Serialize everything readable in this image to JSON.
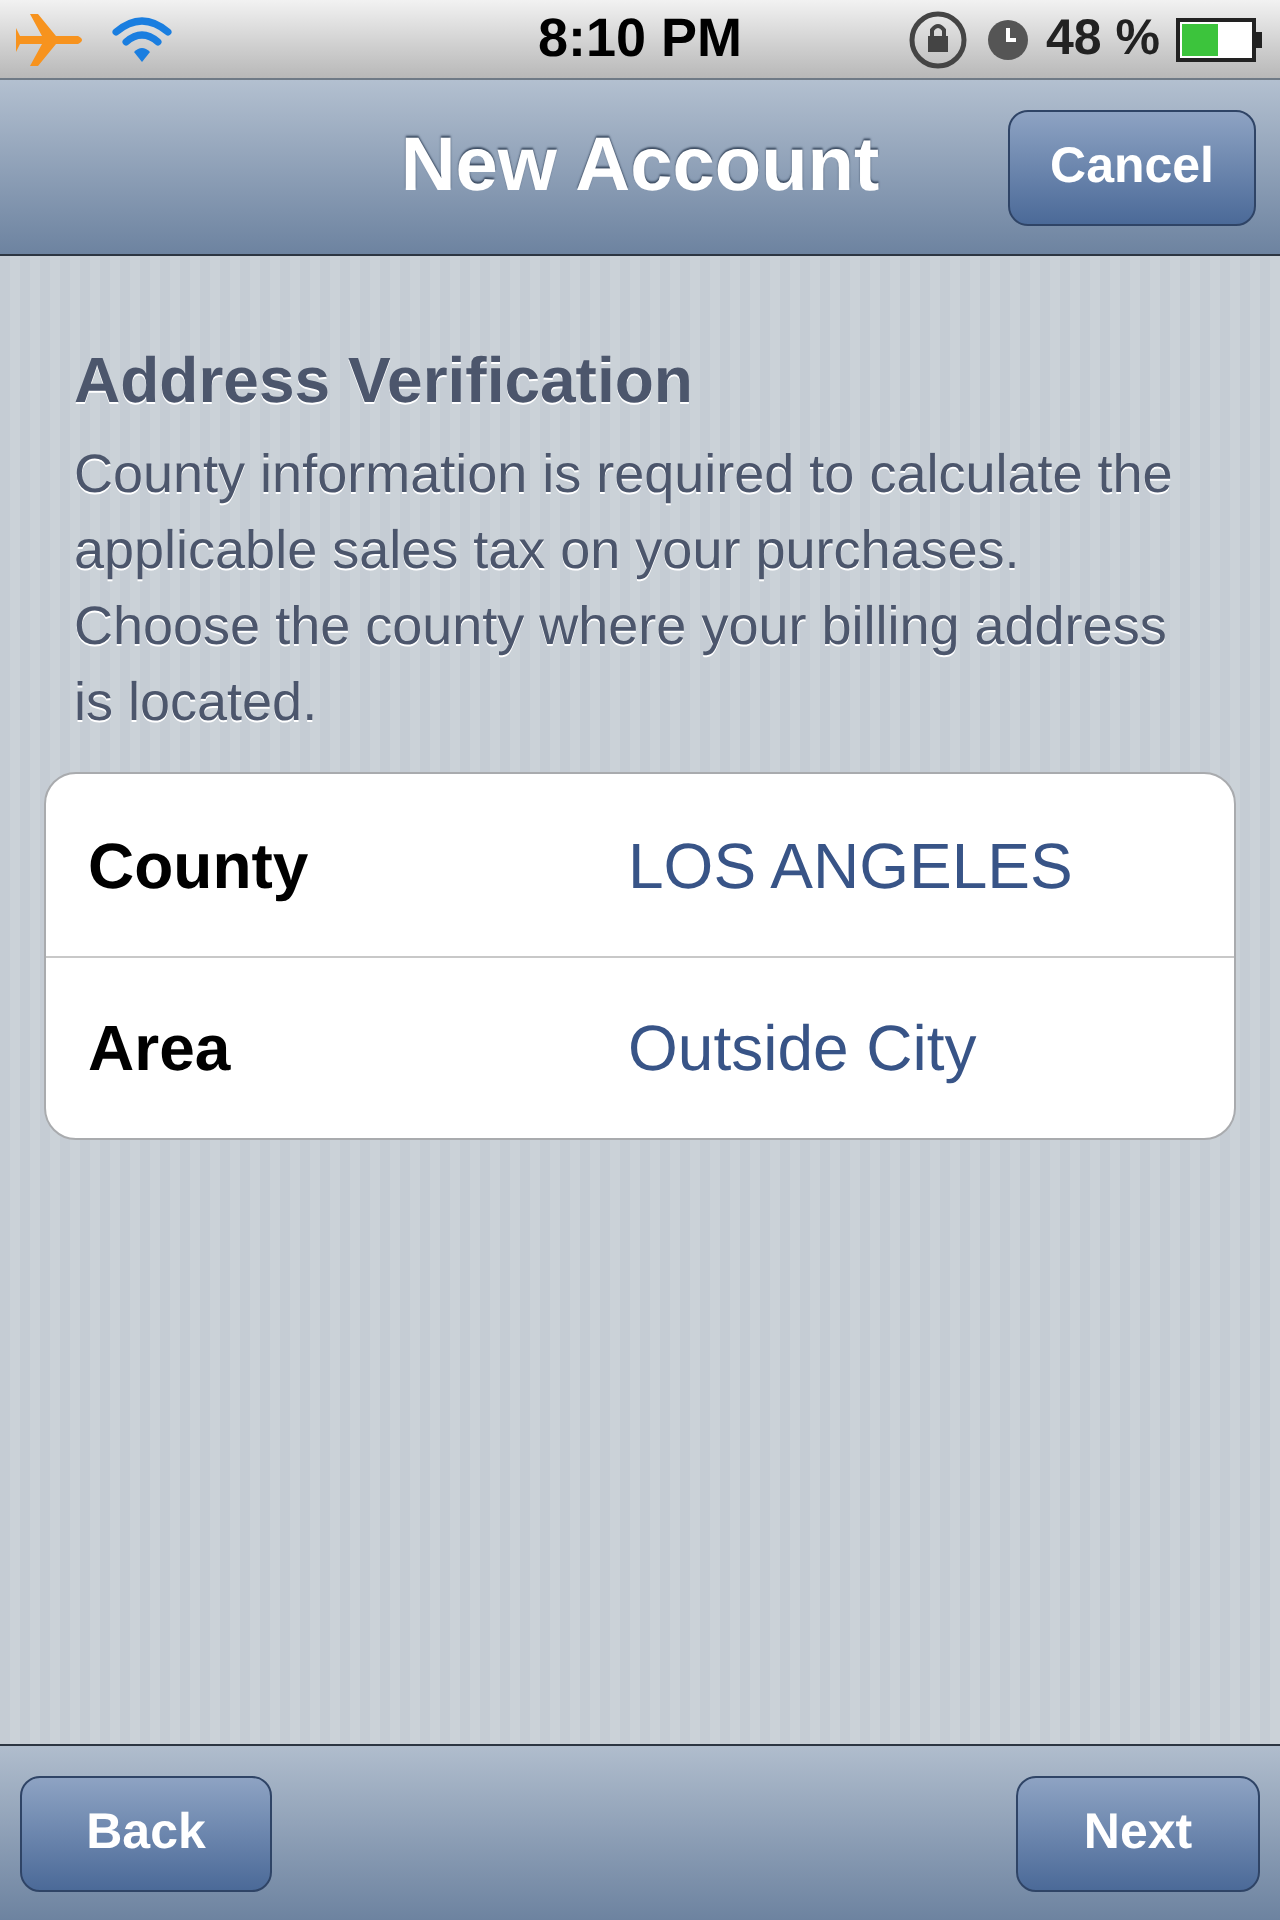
{
  "status_bar": {
    "time": "8:10 PM",
    "battery": "48 %"
  },
  "nav_bar": {
    "title": "New Account",
    "button": "Cancel"
  },
  "section": {
    "title": "Address Verification",
    "description": "County information is required to calculate the applicable sales tax on your purchases. Choose the county where your billing address is located."
  },
  "rows": [
    {
      "label": "County",
      "value": "LOS ANGELES"
    },
    {
      "label": "Area",
      "value": "Outside City"
    }
  ],
  "toolbar": {
    "buttons": [
      "Back",
      "Next"
    ]
  }
}
